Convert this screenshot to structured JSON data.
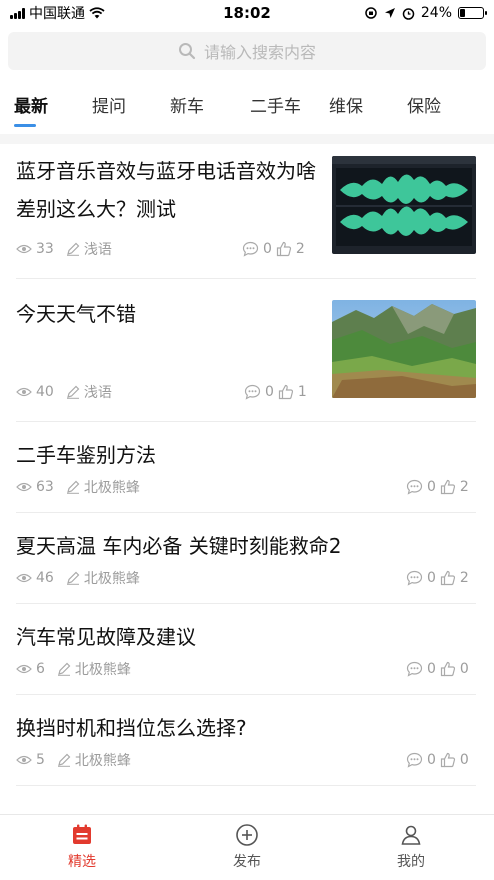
{
  "status_bar": {
    "carrier": "中国联通",
    "time": "18:02",
    "battery": "24%",
    "battery_level": 0.24
  },
  "search": {
    "placeholder": "请输入搜索内容"
  },
  "tabs": [
    {
      "label": "最新",
      "active": true
    },
    {
      "label": "提问"
    },
    {
      "label": "新车"
    },
    {
      "label": "二手车"
    },
    {
      "label": "维保"
    },
    {
      "label": "保险"
    }
  ],
  "articles": [
    {
      "title": "蓝牙音乐音效与蓝牙电话音效为啥差别这么大？测试",
      "views": "33",
      "author": "浅语",
      "comments": "0",
      "likes": "2",
      "thumbnail": "audio-waveform-screenshot"
    },
    {
      "title": "今天天气不错",
      "views": "40",
      "author": "浅语",
      "comments": "0",
      "likes": "1",
      "thumbnail": "green-mountain-landscape"
    },
    {
      "title": "二手车鉴别方法",
      "views": "63",
      "author": "北极熊蜂",
      "comments": "0",
      "likes": "2"
    },
    {
      "title": "夏天高温 车内必备 关键时刻能救命2",
      "views": "46",
      "author": "北极熊蜂",
      "comments": "0",
      "likes": "2"
    },
    {
      "title": "汽车常见故障及建议",
      "views": "6",
      "author": "北极熊蜂",
      "comments": "0",
      "likes": "0"
    },
    {
      "title": "换挡时机和挡位怎么选择?",
      "views": "5",
      "author": "北极熊蜂",
      "comments": "0",
      "likes": "0"
    }
  ],
  "bottom_nav": [
    {
      "label": "精选",
      "icon": "calendar-list-icon",
      "active": true
    },
    {
      "label": "发布",
      "icon": "plus-circle-icon"
    },
    {
      "label": "我的",
      "icon": "user-icon"
    }
  ],
  "colors": {
    "accent_blue": "#3b8fe6",
    "active_red": "#e23a2e",
    "meta_gray": "#9c9c9c"
  }
}
